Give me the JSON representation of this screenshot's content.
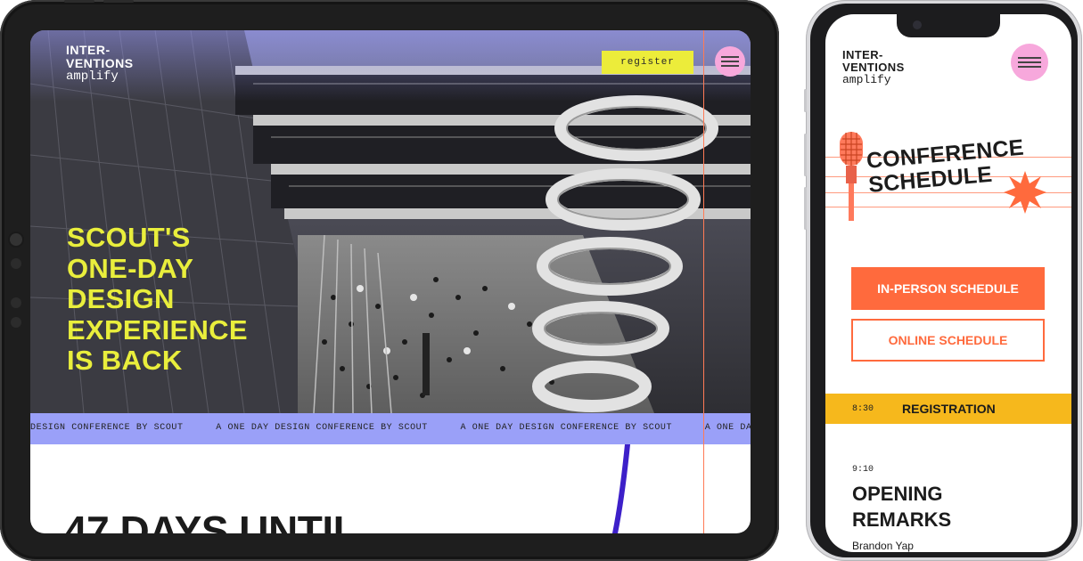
{
  "tablet": {
    "logo": {
      "line1": "INTER-",
      "line2": "VENTIONS",
      "line3": "amplify"
    },
    "register_label": "register",
    "menu_icon": "hamburger-icon",
    "hero_title_lines": [
      "SCOUT'S",
      "ONE-DAY",
      "DESIGN",
      "EXPERIENCE",
      "IS BACK"
    ],
    "ticker_items": [
      "DESIGN CONFERENCE BY SCOUT",
      "A ONE DAY DESIGN CONFERENCE BY SCOUT",
      "A ONE DAY DESIGN CONFERENCE BY SCOUT",
      "A ONE DAY DESIGN CONFERENCE BY SCOUT"
    ],
    "countdown_text": "47 DAYS UNTIL",
    "colors": {
      "accent_yellow": "#e9ee3c",
      "ticker_bg": "#9aa0f8",
      "menu_pink": "#f7a8dc",
      "line_orange": "#ff7a55"
    }
  },
  "phone": {
    "logo": {
      "line1": "INTER-",
      "line2": "VENTIONS",
      "line3": "amplify"
    },
    "menu_icon": "hamburger-icon",
    "schedule_title": [
      "CONFERENCE",
      "SCHEDULE"
    ],
    "decor_icons": [
      "microphone-icon",
      "starburst-icon"
    ],
    "in_person_label": "IN-PERSON SCHEDULE",
    "online_label": "ONLINE SCHEDULE",
    "agenda": [
      {
        "time": "8:30",
        "title": "REGISTRATION"
      },
      {
        "time": "9:10",
        "title_lines": [
          "OPENING",
          "REMARKS"
        ],
        "speaker": "Brandon Yap"
      }
    ],
    "colors": {
      "button_orange": "#ff6a3d",
      "registration_yellow": "#f6b81c"
    }
  }
}
